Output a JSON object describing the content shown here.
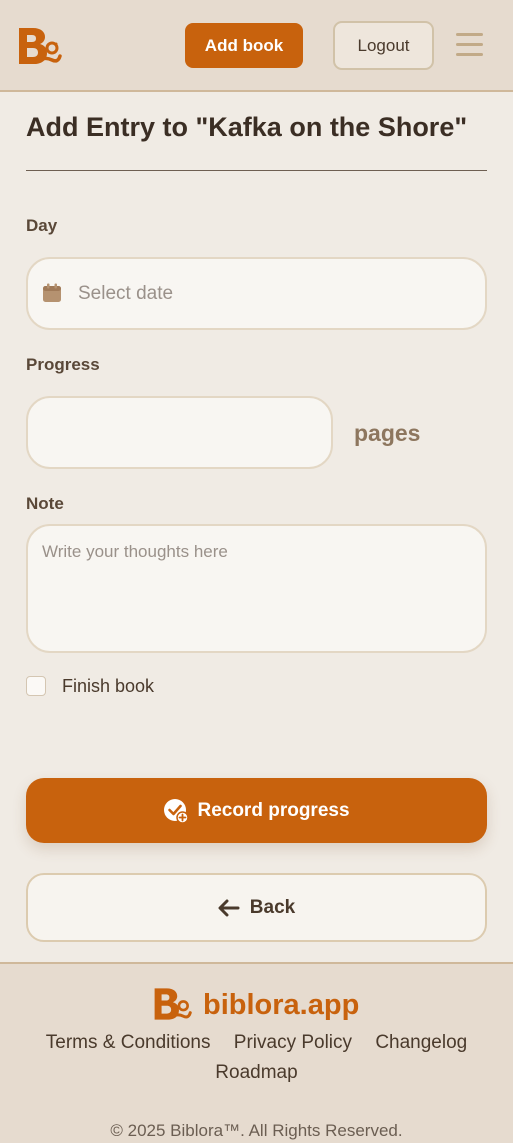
{
  "header": {
    "add_book_label": "Add book",
    "logout_label": "Logout"
  },
  "page": {
    "title": "Add Entry to \"Kafka on the Shore\""
  },
  "form": {
    "day_label": "Day",
    "day_placeholder": "Select date",
    "progress_label": "Progress",
    "progress_value": "",
    "progress_unit": "pages",
    "note_label": "Note",
    "note_placeholder": "Write your thoughts here",
    "finish_label": "Finish book",
    "finish_checked": false
  },
  "actions": {
    "record_label": "Record progress",
    "back_label": "Back"
  },
  "footer": {
    "brand": "biblora.app",
    "links": [
      "Terms & Conditions",
      "Privacy Policy",
      "Changelog",
      "Roadmap"
    ],
    "copyright": "© 2025 Biblora™. All Rights Reserved."
  },
  "colors": {
    "accent": "#c8620d",
    "header_bg": "#e6dbcf",
    "page_bg": "#f0ebe4"
  },
  "icons": {
    "logo": "biblora-logo-icon",
    "menu": "hamburger-menu-icon",
    "calendar": "calendar-icon",
    "record": "check-plus-icon",
    "back": "arrow-left-icon"
  }
}
